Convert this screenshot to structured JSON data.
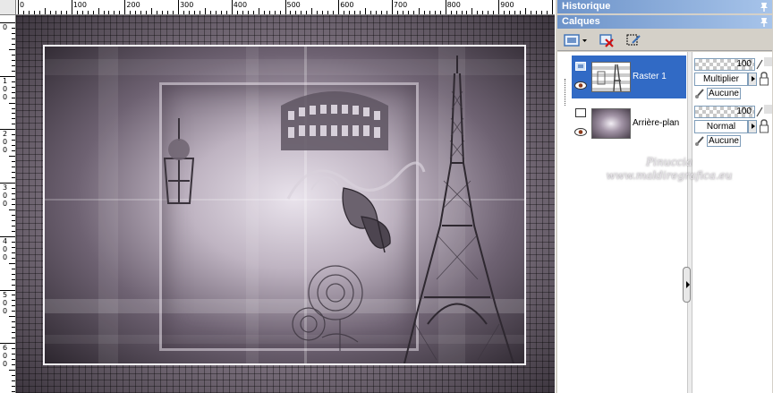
{
  "rulers": {
    "top_labels": [
      "0",
      "100",
      "200",
      "300",
      "400",
      "500",
      "600",
      "700",
      "800",
      "900"
    ],
    "left_labels": [
      [
        "0"
      ],
      [
        "1",
        "0",
        "0"
      ],
      [
        "2",
        "0",
        "0"
      ],
      [
        "3",
        "0",
        "0"
      ],
      [
        "4",
        "0",
        "0"
      ],
      [
        "5",
        "0",
        "0"
      ],
      [
        "6",
        "0",
        "0"
      ]
    ]
  },
  "canvas": {
    "watermark_line1": "Pinuccia",
    "watermark_line2": "www.maldiregrafica.eu"
  },
  "panels": {
    "historique_title": "Historique",
    "calques_title": "Calques"
  },
  "layers": [
    {
      "name": "Raster 1",
      "selected": true,
      "opacity": "100",
      "blend_mode": "Multiplier",
      "mask": "Aucune"
    },
    {
      "name": "Arrière-plan",
      "selected": false,
      "opacity": "100",
      "blend_mode": "Normal",
      "mask": "Aucune"
    }
  ],
  "colors": {
    "titlebar_start": "#6d93c9",
    "titlebar_end": "#a7c4ea",
    "selection": "#316ac5",
    "window_bg": "#d4d0c8"
  },
  "icons": {
    "toolbar": [
      "new-layer-icon",
      "delete-layer-icon",
      "layer-properties-icon"
    ],
    "layer_rows": [
      "layer-type-icon",
      "eye-icon",
      "lock-icon",
      "brush-icon"
    ]
  }
}
